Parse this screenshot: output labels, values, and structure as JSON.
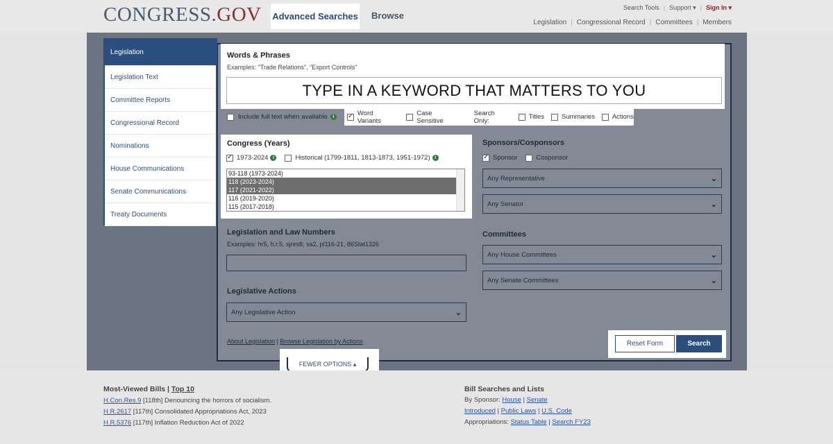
{
  "header": {
    "logo_main": "CONGRESS.",
    "logo_gov": "GOV",
    "tabs": {
      "advanced": "Advanced Searches",
      "browse": "Browse"
    },
    "util": {
      "search_tools": "Search Tools",
      "support": "Support ▾",
      "sign_in": "Sign In ▾"
    },
    "subnav": [
      "Legislation",
      "Congressional Record",
      "Committees",
      "Members"
    ]
  },
  "sidebar": {
    "items": [
      {
        "label": "Legislation"
      },
      {
        "label": "Legislation Text"
      },
      {
        "label": "Committee Reports"
      },
      {
        "label": "Congressional Record"
      },
      {
        "label": "Nominations"
      },
      {
        "label": "House Communications"
      },
      {
        "label": "Senate Communications"
      },
      {
        "label": "Treaty Documents"
      }
    ]
  },
  "words": {
    "title": "Words & Phrases",
    "examples": "Examples: \"Trade Relations\", \"Export Controls\"",
    "value": "TYPE IN A KEYWORD THAT MATTERS TO YOU",
    "full_text": "Include full text when available",
    "word_variants": "Word Variants",
    "case_sensitive": "Case Sensitive",
    "search_only": "Search Only:",
    "titles": "Titles",
    "summaries": "Summaries",
    "actions": "Actions"
  },
  "congress": {
    "title": "Congress (Years)",
    "opt1": "1973-2024",
    "opt2": "Historical (1799-1811, 1813-1873, 1951-1972)",
    "list": [
      "93-118 (1973-2024)",
      "118 (2023-2024)",
      "117 (2021-2022)",
      "116 (2019-2020)",
      "115 (2017-2018)"
    ]
  },
  "sponsors": {
    "title": "Sponsors/Cosponsors",
    "sponsor": "Sponsor",
    "cosponsor": "Cosponsor",
    "rep": "Any Representative",
    "senator": "Any Senator"
  },
  "lawnums": {
    "title": "Legislation and Law Numbers",
    "examples": "Examples: hr5, h.r.5, sjres8, sa2, pl116-21, 86Stat1326"
  },
  "actions": {
    "title": "Legislative Actions",
    "select": "Any Legislative Action"
  },
  "committees": {
    "title": "Committees",
    "house": "Any House Committees",
    "senate": "Any Senate Committees"
  },
  "links": {
    "about": "About Legislation",
    "sep": " | ",
    "browse": "Browse Legislation by Actions"
  },
  "buttons": {
    "reset": "Reset Form",
    "search": "Search",
    "fewer": "FEWER OPTIONS ▴"
  },
  "footer": {
    "left": {
      "title": "Most-Viewed Bills",
      "sep": " | ",
      "top": "Top 10",
      "rows": [
        {
          "link": "H.Con.Res.9",
          "text": " [118th] Denouncing the horrors of socialism."
        },
        {
          "link": "H.R.2617",
          "text": " [117th] Consolidated Appropriations Act, 2023"
        },
        {
          "link": "H.R.5376",
          "text": " [117th] Inflation Reduction Act of 2022"
        }
      ]
    },
    "right": {
      "title": "Bill Searches and Lists",
      "by_sponsor": "By Sponsor: ",
      "house": "House",
      "sep": " | ",
      "senate": "Senate",
      "introduced": "Introduced",
      "public_laws": "Public Laws",
      "us_code": "U.S. Code",
      "approps": "Appropriations: ",
      "status_table": "Status Table",
      "search_fy": "Search FY23"
    }
  }
}
